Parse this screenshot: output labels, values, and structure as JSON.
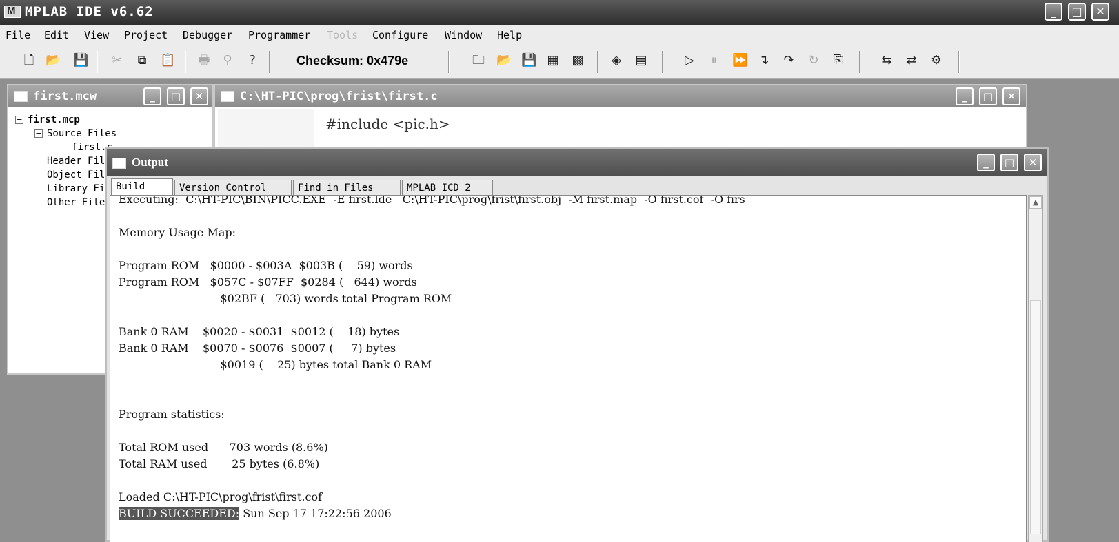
{
  "app": {
    "title": "MPLAB IDE v6.62"
  },
  "window_controls": {
    "minimize": "_",
    "maximize": "□",
    "close": "✕"
  },
  "menu": [
    {
      "label": "File"
    },
    {
      "label": "Edit"
    },
    {
      "label": "View"
    },
    {
      "label": "Project"
    },
    {
      "label": "Debugger"
    },
    {
      "label": "Programmer"
    },
    {
      "label": "Tools",
      "disabled": true
    },
    {
      "label": "Configure"
    },
    {
      "label": "Window"
    },
    {
      "label": "Help"
    }
  ],
  "toolbar": {
    "checksum_label": "Checksum:",
    "checksum_value": "0x479e"
  },
  "project_window": {
    "title": "first.mcw",
    "tree": [
      {
        "label": "first.mcp",
        "level": 0,
        "expander": "−"
      },
      {
        "label": "Source Files",
        "level": 1,
        "expander": "−"
      },
      {
        "label": "first.c",
        "level": 2
      },
      {
        "label": "Header Files",
        "level": 1
      },
      {
        "label": "Object Files",
        "level": 1
      },
      {
        "label": "Library Files",
        "level": 1
      },
      {
        "label": "Other Files",
        "level": 1
      }
    ]
  },
  "editor_window": {
    "title": "C:\\HT-PIC\\prog\\frist\\first.c",
    "code_line": "#include <pic.h>"
  },
  "output_window": {
    "title": "Output",
    "tabs": [
      {
        "label": "Build",
        "active": true
      },
      {
        "label": "Version Control"
      },
      {
        "label": "Find in Files"
      },
      {
        "label": "MPLAB ICD 2"
      }
    ],
    "lines": [
      "Executing:  C:\\HT-PIC\\BIN\\PICC.EXE  -E first.lde   C:\\HT-PIC\\prog\\frist\\first.obj  -M first.map  -O first.cof  -O firs",
      "",
      "Memory Usage Map:",
      "",
      "Program ROM   $0000 - $003A  $003B (    59) words",
      "Program ROM   $057C - $07FF  $0284 (   644) words",
      "                             $02BF (   703) words total Program ROM",
      "",
      "Bank 0 RAM    $0020 - $0031  $0012 (    18) bytes",
      "Bank 0 RAM    $0070 - $0076  $0007 (     7) bytes",
      "                             $0019 (    25) bytes total Bank 0 RAM",
      "",
      "",
      "Program statistics:",
      "",
      "Total ROM used      703 words (8.6%)",
      "Total RAM used       25 bytes (6.8%)",
      "",
      "Loaded C:\\HT-PIC\\prog\\frist\\first.cof"
    ],
    "build_status": "BUILD SUCCEEDED:",
    "build_time": " Sun Sep 17 17:22:56 2006"
  }
}
